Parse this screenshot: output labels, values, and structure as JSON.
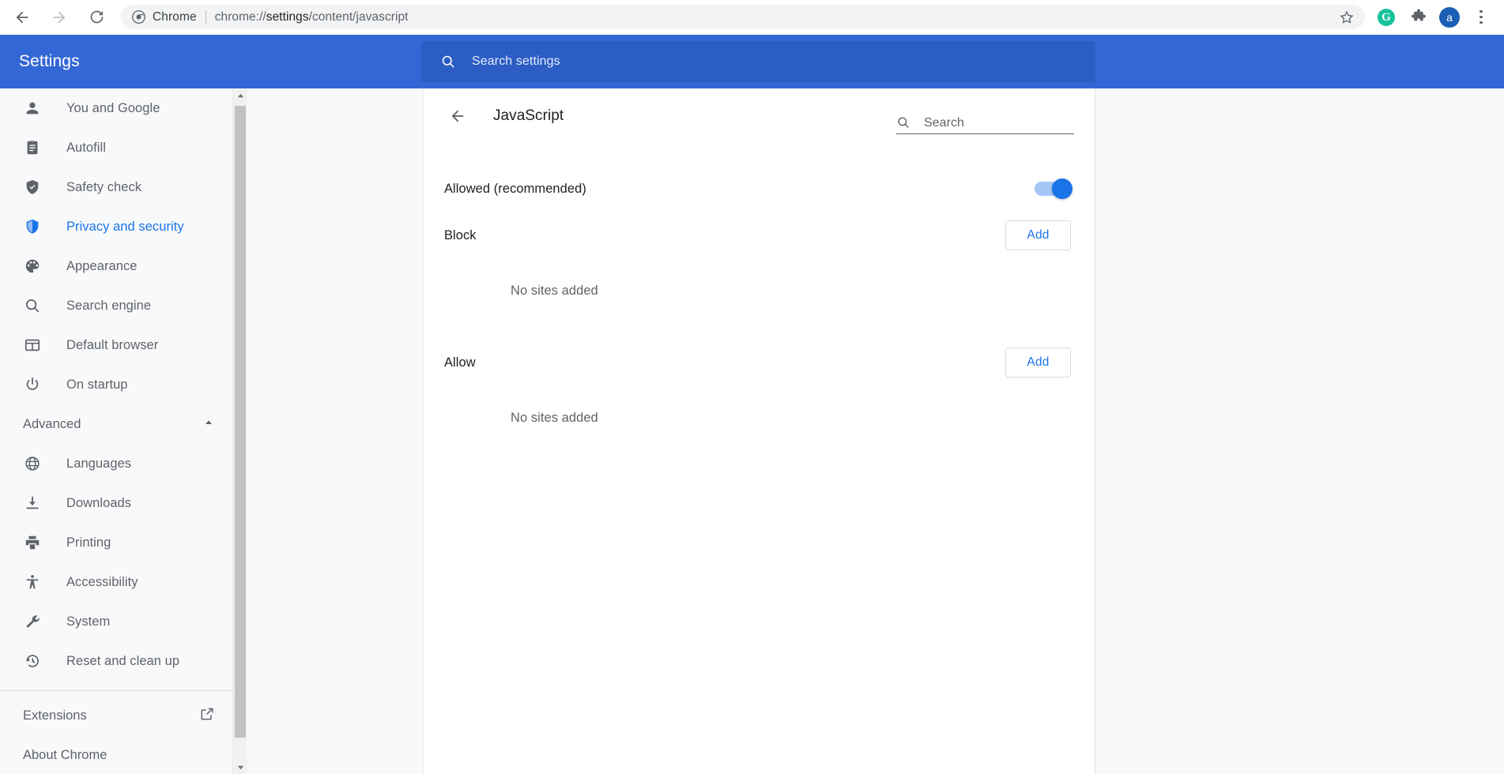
{
  "browser": {
    "back_icon": "back-arrow-icon",
    "forward_icon": "forward-arrow-icon",
    "reload_icon": "reload-icon",
    "omnibox": {
      "chrome_icon": "chrome-logo-icon",
      "scheme_label": "Chrome",
      "url_prefix": "chrome://",
      "url_bold": "settings",
      "url_suffix": "/content/javascript",
      "full_url": "chrome://settings/content/javascript",
      "star_icon": "bookmark-star-icon"
    },
    "toolbar_icons": {
      "grammarly_label": "G",
      "grammarly_icon": "grammarly-extension-icon",
      "extensions_icon": "puzzle-piece-icon",
      "avatar_label": "a",
      "avatar_icon": "profile-avatar-icon",
      "menu_icon": "three-dot-menu-icon"
    }
  },
  "settings_header": {
    "title": "Settings",
    "search": {
      "icon": "search-icon",
      "placeholder": "Search settings",
      "value": ""
    }
  },
  "sidebar": {
    "items": [
      {
        "label": "You and Google",
        "icon": "person-icon",
        "selected": false
      },
      {
        "label": "Autofill",
        "icon": "clipboard-icon",
        "selected": false
      },
      {
        "label": "Safety check",
        "icon": "shield-check-icon",
        "selected": false
      },
      {
        "label": "Privacy and security",
        "icon": "shield-icon",
        "selected": true
      },
      {
        "label": "Appearance",
        "icon": "palette-icon",
        "selected": false
      },
      {
        "label": "Search engine",
        "icon": "magnifier-icon",
        "selected": false
      },
      {
        "label": "Default browser",
        "icon": "browser-window-icon",
        "selected": false
      },
      {
        "label": "On startup",
        "icon": "power-icon",
        "selected": false
      }
    ],
    "advanced": {
      "label": "Advanced",
      "chevron_icon": "chevron-up-icon",
      "expanded": true,
      "items": [
        {
          "label": "Languages",
          "icon": "globe-icon"
        },
        {
          "label": "Downloads",
          "icon": "download-icon"
        },
        {
          "label": "Printing",
          "icon": "printer-icon"
        },
        {
          "label": "Accessibility",
          "icon": "accessibility-icon"
        },
        {
          "label": "System",
          "icon": "wrench-icon"
        },
        {
          "label": "Reset and clean up",
          "icon": "history-restore-icon"
        }
      ]
    },
    "extensions": {
      "label": "Extensions",
      "icon": "external-link-icon"
    },
    "about": {
      "label": "About Chrome"
    },
    "scrollbar": {
      "up_icon": "scroll-up-arrow-icon",
      "down_icon": "scroll-down-arrow-icon"
    }
  },
  "content": {
    "back_icon": "back-arrow-icon",
    "title": "JavaScript",
    "search": {
      "icon": "search-icon",
      "placeholder": "Search",
      "value": ""
    },
    "allowed_row": {
      "label": "Allowed (recommended)",
      "toggle_on": true
    },
    "sections": [
      {
        "title": "Block",
        "add_label": "Add",
        "empty_text": "No sites added"
      },
      {
        "title": "Allow",
        "add_label": "Add",
        "empty_text": "No sites added"
      }
    ]
  },
  "colors": {
    "header_blue": "#3367d6",
    "search_blue": "#2b5dc4",
    "accent_blue": "#1a73e8",
    "page_bg": "#f8f9fa",
    "text_primary": "#202124",
    "text_secondary": "#5f6368"
  }
}
